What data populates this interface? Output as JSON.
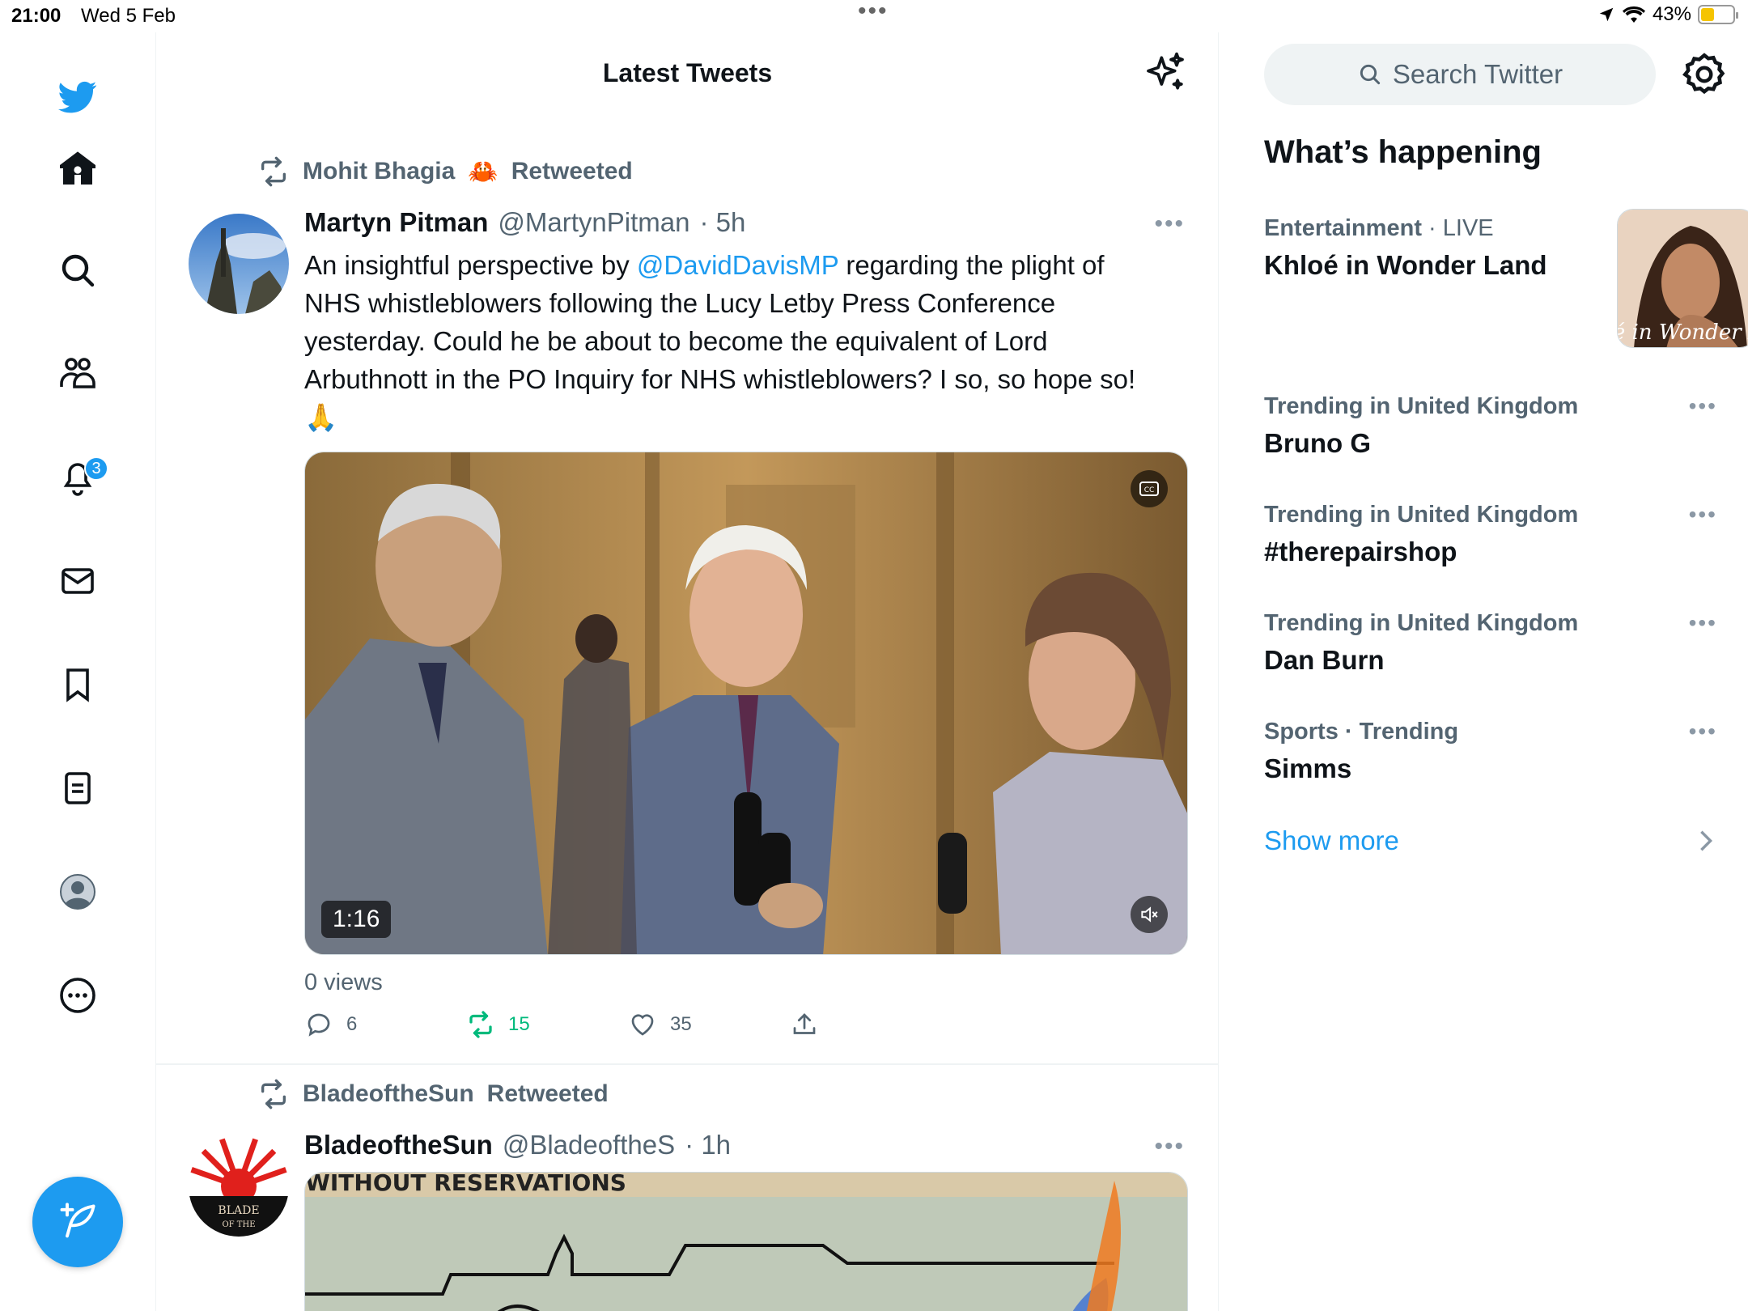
{
  "status_bar": {
    "time": "21:00",
    "date": "Wed 5 Feb",
    "battery": "43%",
    "battery_level": 0.43
  },
  "nav": {
    "notifications_badge": "3"
  },
  "timeline": {
    "title": "Latest Tweets",
    "tweets": [
      {
        "retweeted_by": "Mohit Bhagia",
        "retweeted_emoji": "🦀",
        "retweeted_label": "Retweeted",
        "name": "Martyn Pitman",
        "handle": "@MartynPitman",
        "time": "· 5h",
        "text_before": "An insightful perspective by ",
        "mention": "@DavidDavisMP",
        "text_after": " regarding the plight of NHS whistleblowers following the Lucy Letby Press Conference yesterday. Could he be about to become the equivalent of Lord Arbuthnott in the PO Inquiry for NHS whistleblowers? I so, so hope so! 🙏",
        "video_duration": "1:16",
        "views": "0 views",
        "replies": "6",
        "retweets": "15",
        "likes": "35"
      },
      {
        "retweeted_by": "BladeoftheSun",
        "retweeted_label": "Retweeted",
        "name": "BladeoftheSun",
        "handle": "@BladeoftheS",
        "time": "· 1h",
        "media_caption": "WITHOUT RESERVATIONS",
        "avatar_text_1": "BLADE",
        "avatar_text_2": "OF THE"
      }
    ]
  },
  "sidebar": {
    "search_placeholder": "Search Twitter",
    "whats_happening": "What’s happening",
    "trends": [
      {
        "category": "Entertainment",
        "live": " · LIVE",
        "topic": "Khloé in Wonder Land",
        "image_caption": "é in Wonder L"
      },
      {
        "category": "Trending in United Kingdom",
        "topic": "Bruno G"
      },
      {
        "category": "Trending in United Kingdom",
        "topic": "#therepairshop"
      },
      {
        "category": "Trending in United Kingdom",
        "topic": "Dan Burn"
      },
      {
        "category": "Sports · Trending",
        "topic": "Simms"
      }
    ],
    "show_more": "Show more"
  },
  "colors": {
    "accent": "#1d9bf0",
    "retweet_green": "#00ba7c",
    "secondary_text": "#536471"
  }
}
